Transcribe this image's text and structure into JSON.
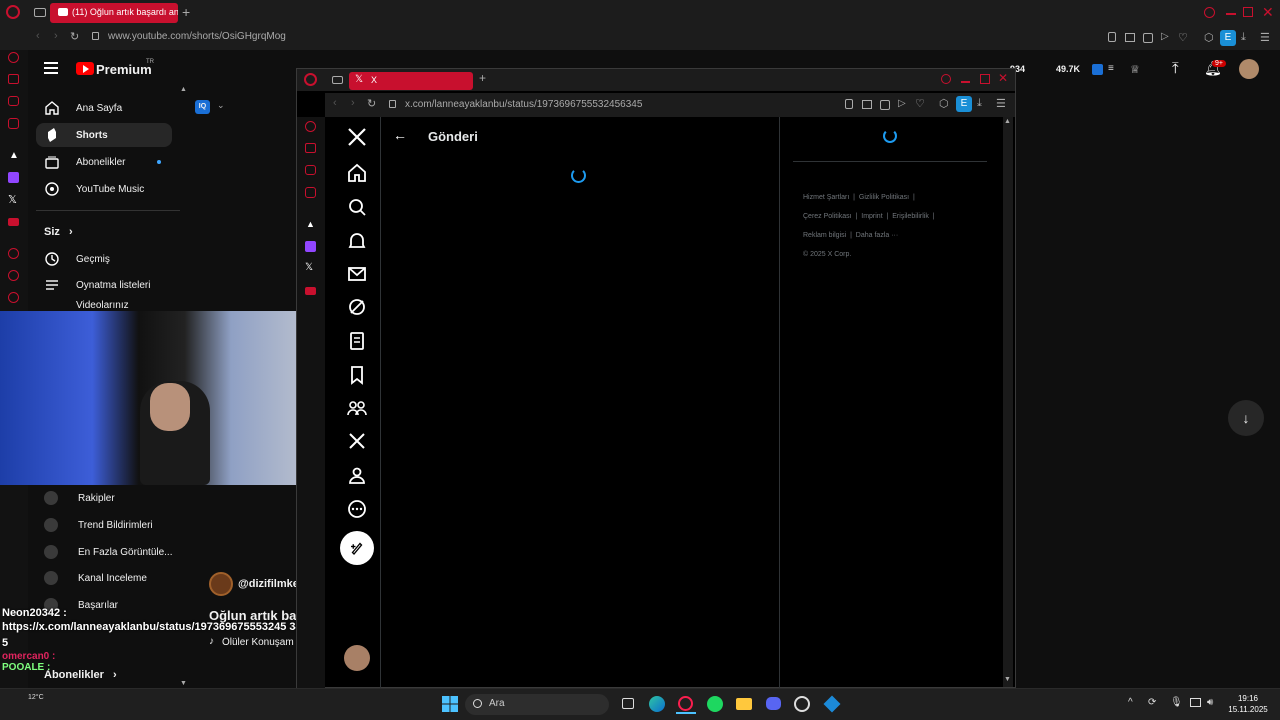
{
  "outer_browser": {
    "tab_title": "(11) Oğlun artık başardı an",
    "url": "www.youtube.com/shorts/OsiGHgrqMog"
  },
  "youtube": {
    "premium_label": "Premium",
    "premium_region": "TR",
    "stats": {
      "likes": "934",
      "views": "49.7K"
    },
    "notifications_badge": "9+",
    "nav": [
      {
        "label": "Ana Sayfa",
        "icon": "home-icon"
      },
      {
        "label": "Shorts",
        "icon": "shorts-icon"
      },
      {
        "label": "Abonelikler",
        "icon": "subscriptions-icon"
      },
      {
        "label": "YouTube Music",
        "icon": "music-icon"
      }
    ],
    "you_section": "Siz",
    "you_items": [
      {
        "label": "Geçmiş",
        "icon": "history-icon"
      },
      {
        "label": "Oynatma listeleri",
        "icon": "playlist-icon"
      },
      {
        "label": "Videolarınız",
        "icon": "video-icon"
      }
    ],
    "tools": [
      "Rakipler",
      "Trend Bildirimleri",
      "En Fazla Görüntüle...",
      "Kanal Inceleme",
      "Başarılar"
    ],
    "subscriptions_label": "Abonelikler",
    "short": {
      "channel": "@dizifilmke",
      "title": "Oğlun artık ba",
      "sound": "Ölüler Konuşam"
    }
  },
  "chat": [
    {
      "user": "Neon20342 :",
      "text": "https://x.com/lanneayaklanbu/status/197369675553245 345"
    },
    {
      "user": "omercan0 :",
      "text": ""
    },
    {
      "user": "POOALE :",
      "text": ""
    }
  ],
  "x_window": {
    "tab_title": "X",
    "url": "x.com/lanneayaklanbu/status/1973696755532456345",
    "page_title": "Gönderi",
    "footer": {
      "links": [
        "Hizmet Şartları",
        "Gizlilik Politikası",
        "Çerez Politikası",
        "Imprint",
        "Erişilebilirlik",
        "Reklam bilgisi",
        "Daha fazla ···"
      ],
      "copyright": "© 2025 X Corp."
    }
  },
  "taskbar": {
    "search": "Ara",
    "weather_temp": "12°C",
    "time": "19:16",
    "date": "15.11.2025"
  },
  "colors": {
    "opera_red": "#c8102e",
    "youtube_red": "#ff0000",
    "x_blue": "#1d9bf0",
    "background": "#0f0f0f"
  }
}
